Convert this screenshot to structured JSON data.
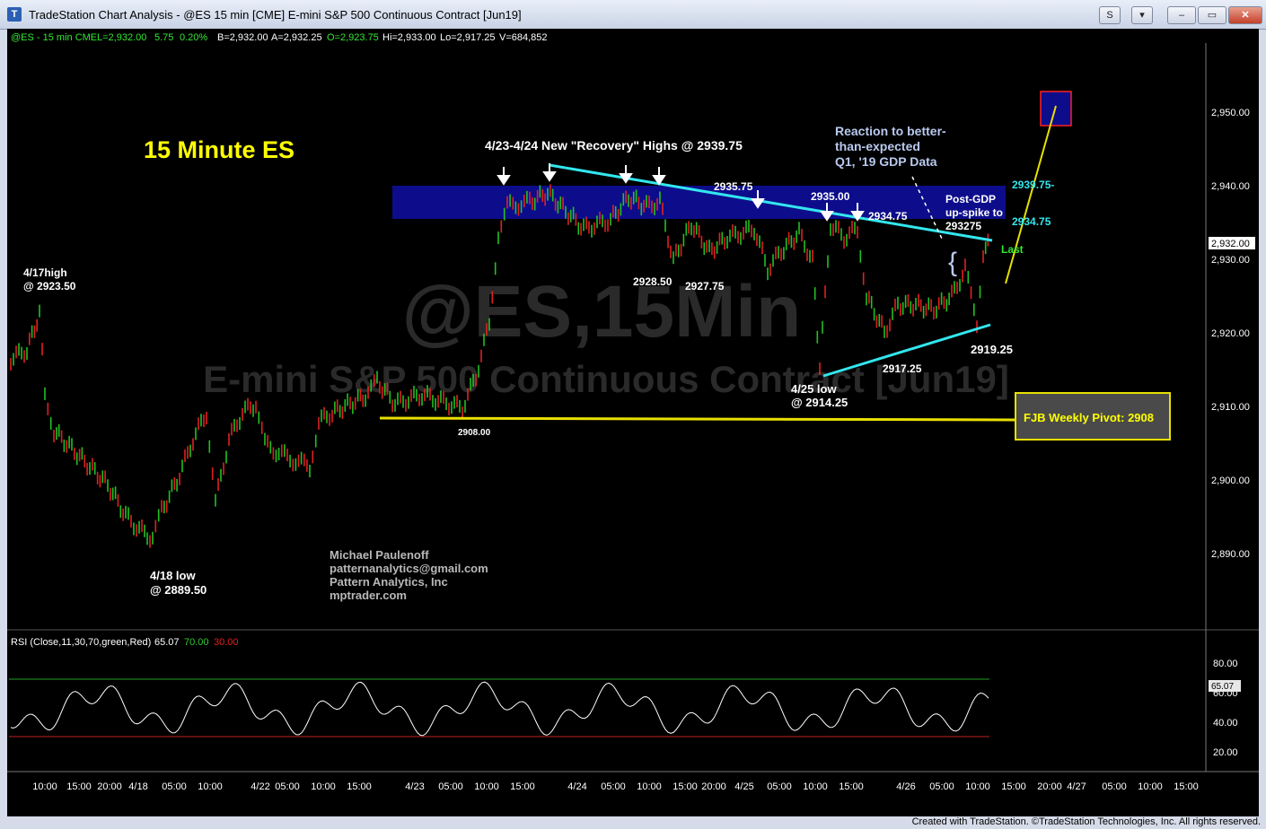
{
  "window": {
    "title": "TradeStation Chart Analysis - @ES 15 min [CME] E-mini S&P 500 Continuous Contract [Jun19]",
    "app_icon": "tradestation-icon",
    "buttons": {
      "s": "S",
      "dropdown": "▾",
      "minimize": "–",
      "restore": "▭",
      "close": "✕"
    }
  },
  "header": {
    "symbol": "@ES - 15 min  CME",
    "last": "L=2,932.00",
    "change": "5.75",
    "pct": "0.20%",
    "bid": "B=2,932.00",
    "ask": "A=2,932.25",
    "open": "O=2,923.75",
    "high": "Hi=2,933.00",
    "low": "Lo=2,917.25",
    "volume": "V=684,852"
  },
  "watermark": {
    "symbol": "@ES,15Min",
    "name": "E-mini S&P 500 Continuous Contract [Jun19]"
  },
  "annotations": {
    "title": "15 Minute ES",
    "recovery": "4/23-4/24 New \"Recovery\" Highs @ 2939.75",
    "reaction_1": "Reaction to better-",
    "reaction_2": "than-expected",
    "reaction_3": "Q1, '19 GDP Data",
    "post_gdp_1": "Post-GDP",
    "post_gdp_2": "up-spike to",
    "post_gdp_3": "293275",
    "high_417_1": "4/17high",
    "high_417_2": "@ 2923.50",
    "low_418_1": "4/18 low",
    "low_418_2": "@ 2889.50",
    "low_425_1": "4/25 low",
    "low_425_2": "@ 2914.25",
    "lvl_2935_75": "2935.75",
    "lvl_2935_00": "2935.00",
    "lvl_2934_75": "2934.75",
    "lvl_2928_50": "2928.50",
    "lvl_2927_75": "2927.75",
    "lvl_2917_25": "2917.25",
    "lvl_2919_25": "2919.25",
    "lvl_2908_00": "2908.00",
    "cyan_2939_75": "2939.75-",
    "cyan_2934_75": "2934.75",
    "last_label": "Last",
    "pivot": "FJB Weekly Pivot: 2908",
    "author_1": "Michael Paulenoff",
    "author_2": "patternanalytics@gmail.com",
    "author_3": "Pattern Analytics, Inc",
    "author_4": "mptrader.com"
  },
  "price_axis": {
    "ticks": [
      "2,950.00",
      "2,940.00",
      "2,930.00",
      "2,920.00",
      "2,910.00",
      "2,900.00",
      "2,890.00"
    ],
    "last_marker": "2,932.00"
  },
  "rsi": {
    "label": "RSI (Close,11,30,70,green,Red)",
    "value": "65.07",
    "upper": "70.00",
    "lower": "30.00",
    "ticks": [
      "80.00",
      "60.00",
      "40.00",
      "20.00"
    ],
    "marker": "65.07"
  },
  "time_axis": {
    "labels": [
      "10:00",
      "15:00",
      "20:00",
      "4/18",
      "05:00",
      "10:00",
      "4/22",
      "05:00",
      "10:00",
      "15:00",
      "4/23",
      "05:00",
      "10:00",
      "15:00",
      "4/24",
      "05:00",
      "10:00",
      "15:00",
      "20:00",
      "4/25",
      "05:00",
      "10:00",
      "15:00",
      "4/26",
      "05:00",
      "10:00",
      "15:00",
      "20:00",
      "4/27",
      "05:00",
      "10:00",
      "15:00"
    ]
  },
  "footer": {
    "credit": "Created with TradeStation. ©TradeStation Technologies, Inc. All rights reserved."
  },
  "colors": {
    "background": "#000000",
    "title_yellow": "#ffff00",
    "cyan": "#33e6ee",
    "zone_blue": "#0d0d8c",
    "pivot_yellow": "#e8e000",
    "candle_up": "#22c022",
    "candle_down": "#e02020",
    "rsi_line": "#ffffff"
  }
}
